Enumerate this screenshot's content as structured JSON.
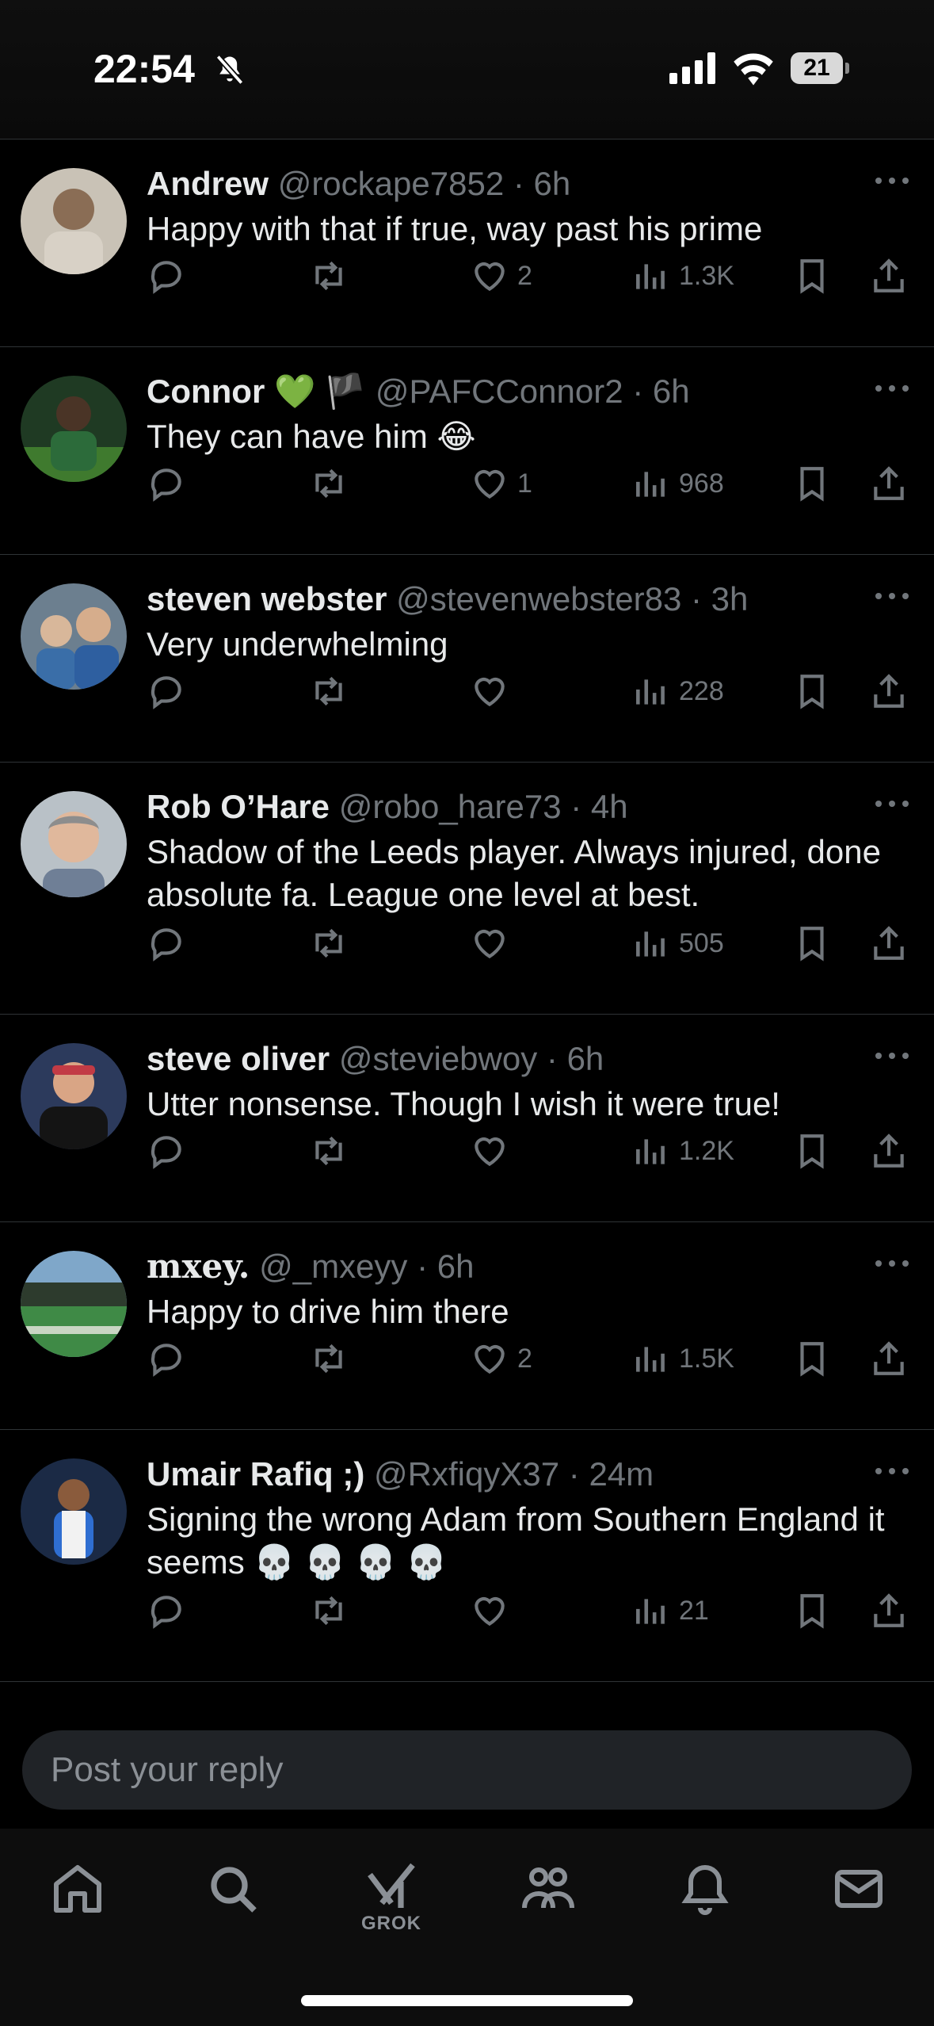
{
  "status_bar": {
    "time": "22:54",
    "battery": "21",
    "icons": [
      "mute-icon",
      "signal-icon",
      "wifi-icon",
      "battery-icon"
    ]
  },
  "posts": [
    {
      "name": "Andrew",
      "handle": "@rockape7852",
      "time": "6h",
      "text": "Happy with that if true, way past his prime",
      "likes": "2",
      "views": "1.3K",
      "avatar_color": "#8a7f74"
    },
    {
      "name": "Connor 💚 🏴",
      "handle": "@PAFCConnor2",
      "time": "6h",
      "text": "They can have him 😂",
      "likes": "1",
      "views": "968",
      "avatar_color": "#2d5a2f"
    },
    {
      "name": "steven webster",
      "handle": "@stevenwebster83",
      "time": "3h",
      "text": "Very underwhelming",
      "likes": "",
      "views": "228",
      "avatar_color": "#5f7894"
    },
    {
      "name": "Rob O’Hare",
      "handle": "@robo_hare73",
      "time": "4h",
      "text": "Shadow of the Leeds player. Always injured, done absolute fa. League one level at best.",
      "likes": "",
      "views": "505",
      "avatar_color": "#9aa4ac"
    },
    {
      "name": "steve oliver",
      "handle": "@steviebwoy",
      "time": "6h",
      "text": "Utter nonsense. Though I wish it were true!",
      "likes": "",
      "views": "1.2K",
      "avatar_color": "#2f3a55"
    },
    {
      "name": "mxey.",
      "handle": "@_mxeyy",
      "time": "6h",
      "text": "Happy to drive him there",
      "likes": "2",
      "views": "1.5K",
      "avatar_color": "#3d6b45"
    },
    {
      "name": "Umair Rafiq ;)",
      "handle": "@RxfiqyX37",
      "time": "24m",
      "text": "Signing the wrong Adam from Southern England it seems 💀 💀 💀 💀",
      "likes": "",
      "views": "21",
      "avatar_color": "#2b3d63"
    }
  ],
  "reply": {
    "placeholder": "Post your reply"
  },
  "nav": {
    "items": [
      "home-icon",
      "search-icon",
      "grok-icon",
      "communities-icon",
      "notifications-icon",
      "messages-icon"
    ],
    "grok_label": "GROK"
  },
  "colors": {
    "background": "#000000",
    "text": "#e7e9ea",
    "muted": "#71767b",
    "divider": "#2f3336",
    "reply_bg": "#202327"
  }
}
